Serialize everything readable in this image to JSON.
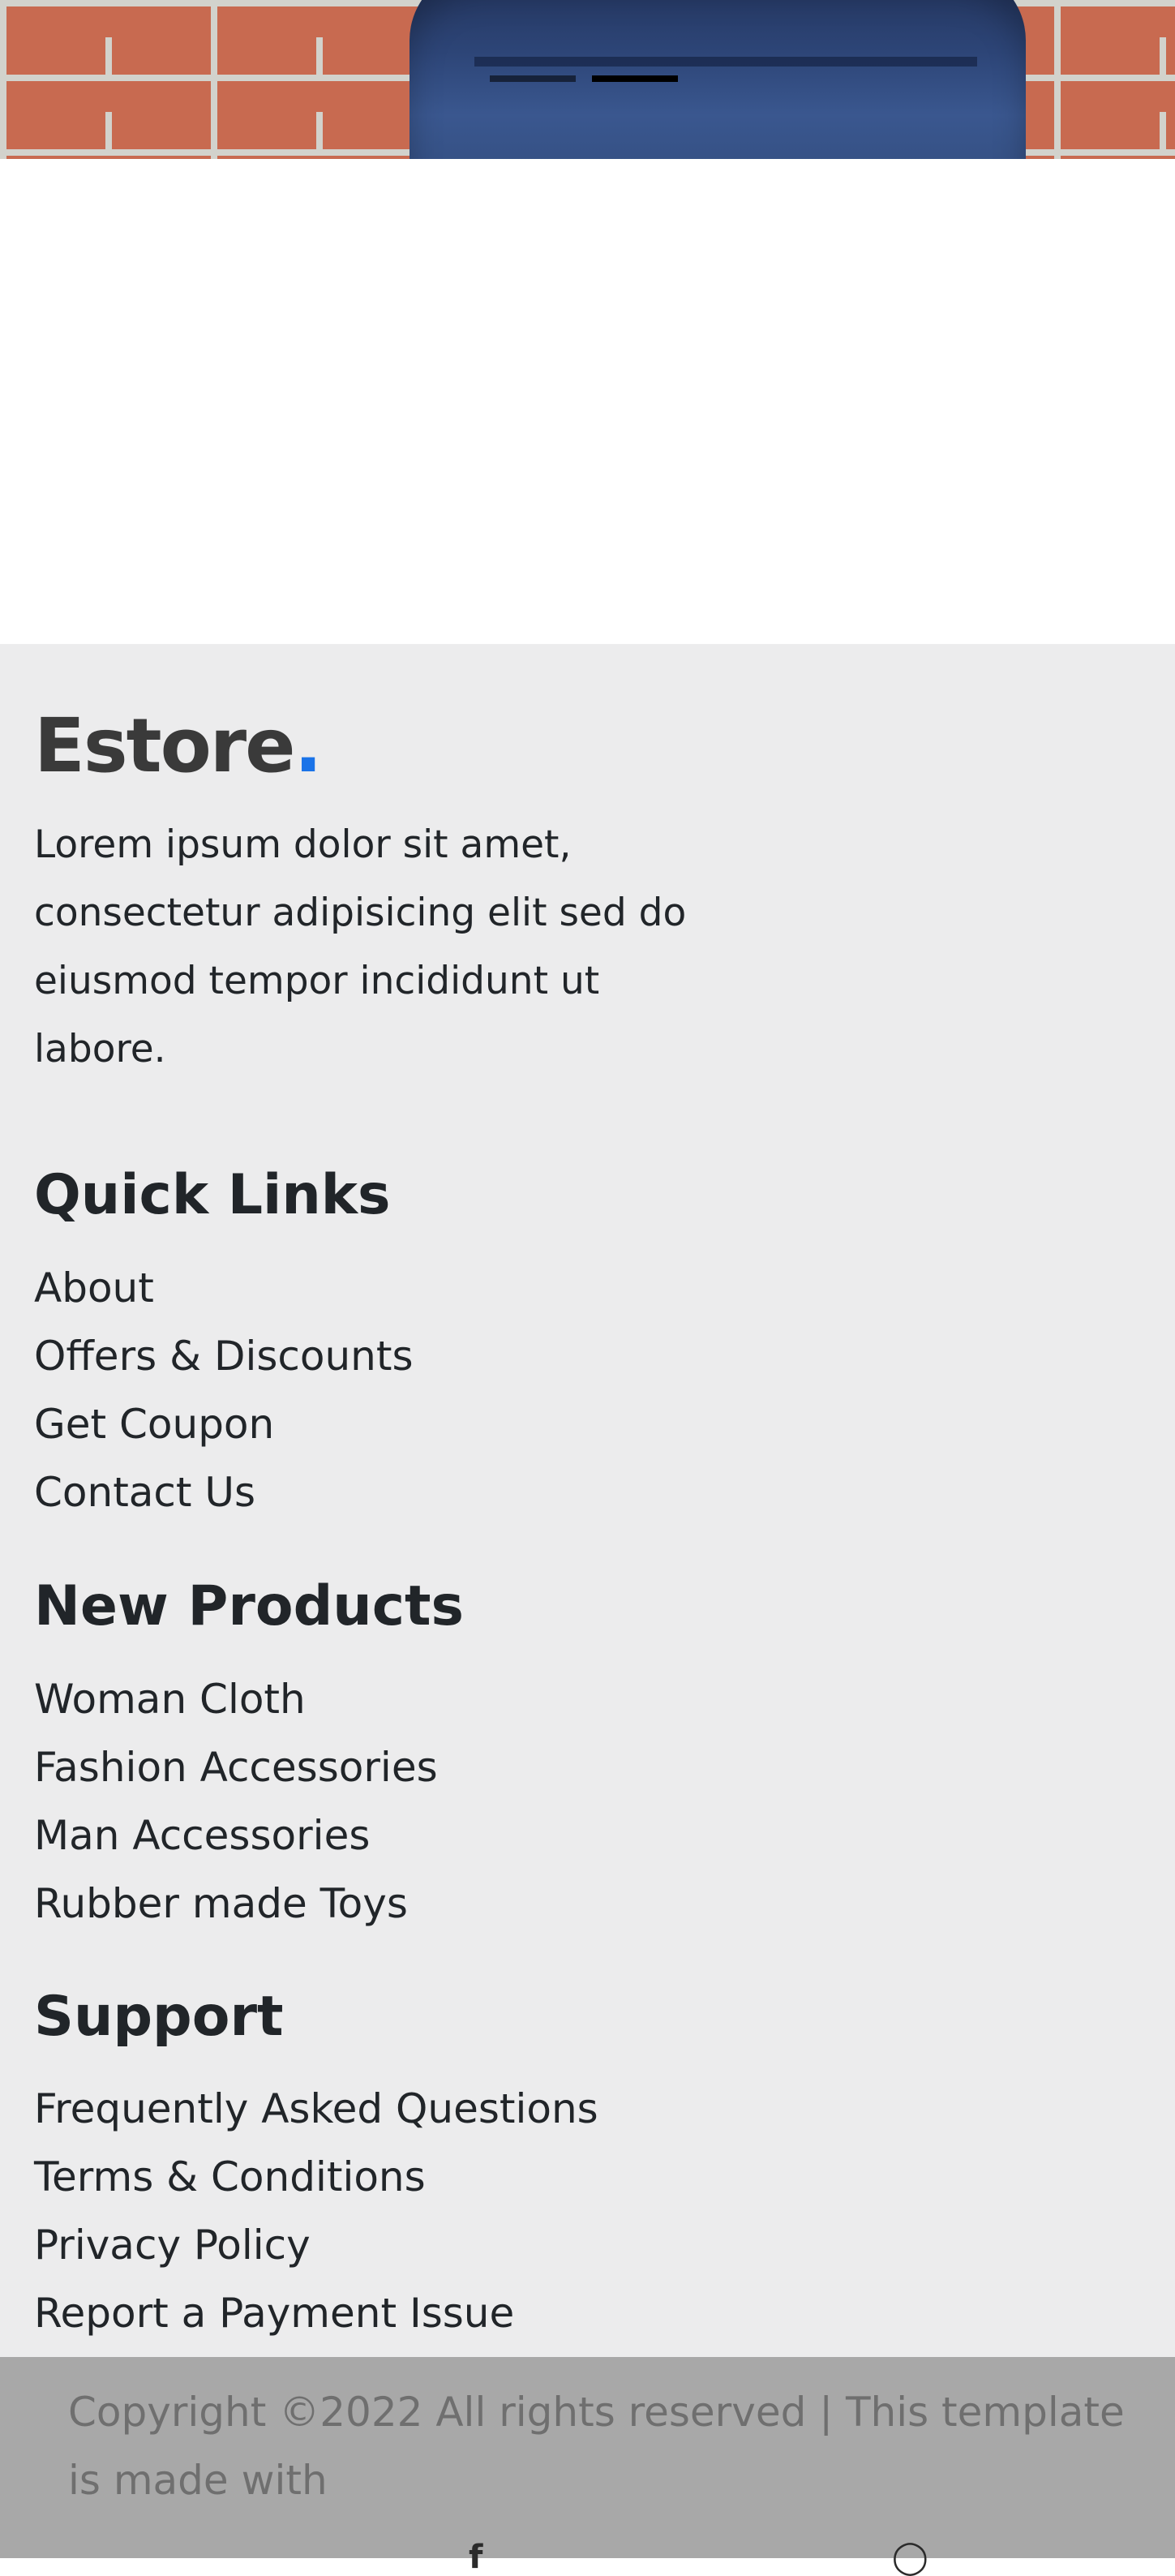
{
  "hero": {
    "indicators": [
      {
        "label": "Slide 1",
        "active": false
      },
      {
        "label": "Slide 2",
        "active": true
      }
    ]
  },
  "footer": {
    "brand": {
      "name": "Estore",
      "dot": ".",
      "dot_color": "#1a73e8"
    },
    "about": "Lorem ipsum dolor sit amet, consectetur adipisicing elit sed do eiusmod tempor incididunt ut labore.",
    "quick_links": {
      "title": "Quick Links",
      "items": [
        "About",
        "Offers & Discounts",
        "Get Coupon",
        "Contact Us"
      ]
    },
    "new_products": {
      "title": "New Products",
      "items": [
        "Woman Cloth",
        "Fashion Accessories",
        "Man Accessories",
        "Rubber made Toys"
      ]
    },
    "support": {
      "title": "Support",
      "items": [
        "Frequently Asked Questions",
        "Terms & Conditions",
        "Privacy Policy",
        "Report a Payment Issue"
      ]
    }
  },
  "copyright": {
    "text": "Copyright ©2022 All rights reserved | This template is made with"
  },
  "colors": {
    "footer_bg": "#ececed",
    "copyright_bg": "#a8a8a8",
    "accent": "#1a73e8"
  },
  "icons": [
    "facebook-icon",
    "instagram-icon"
  ]
}
